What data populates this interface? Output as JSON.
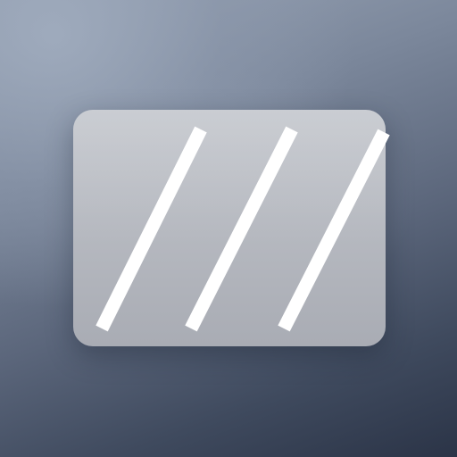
{
  "icon": {
    "symbol": "rectangle-with-diagonal-stripes-icon",
    "card_color": "#b9bcc3",
    "stripe_color": "#ffffff",
    "background_top": "#9aa5b6",
    "background_bottom": "#2b3447"
  }
}
